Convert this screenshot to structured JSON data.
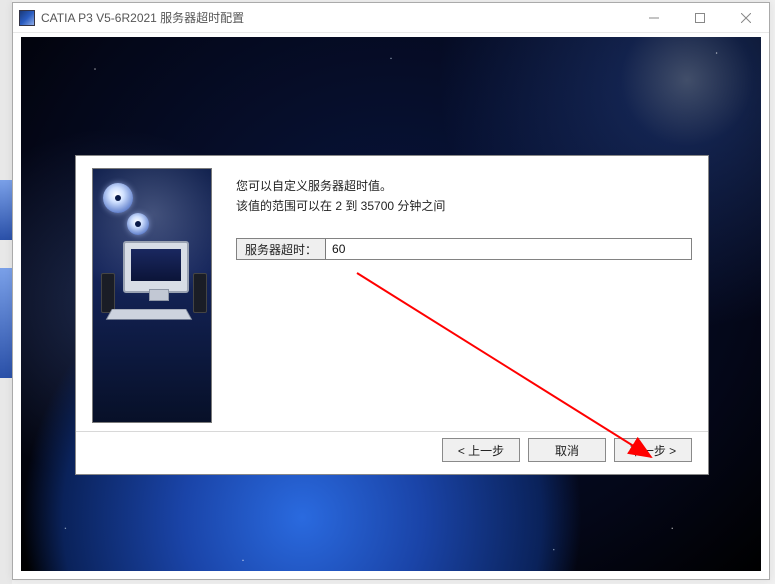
{
  "window": {
    "title": "CATIA P3 V5-6R2021 服务器超时配置"
  },
  "dialog": {
    "desc_line1": "您可以自定义服务器超时值。",
    "desc_line2": "该值的范围可以在 2 到 35700 分钟之间",
    "field_label": "服务器超时：",
    "field_value": "60",
    "buttons": {
      "back": "< 上一步",
      "cancel": "取消",
      "next": "下一步 >"
    }
  }
}
